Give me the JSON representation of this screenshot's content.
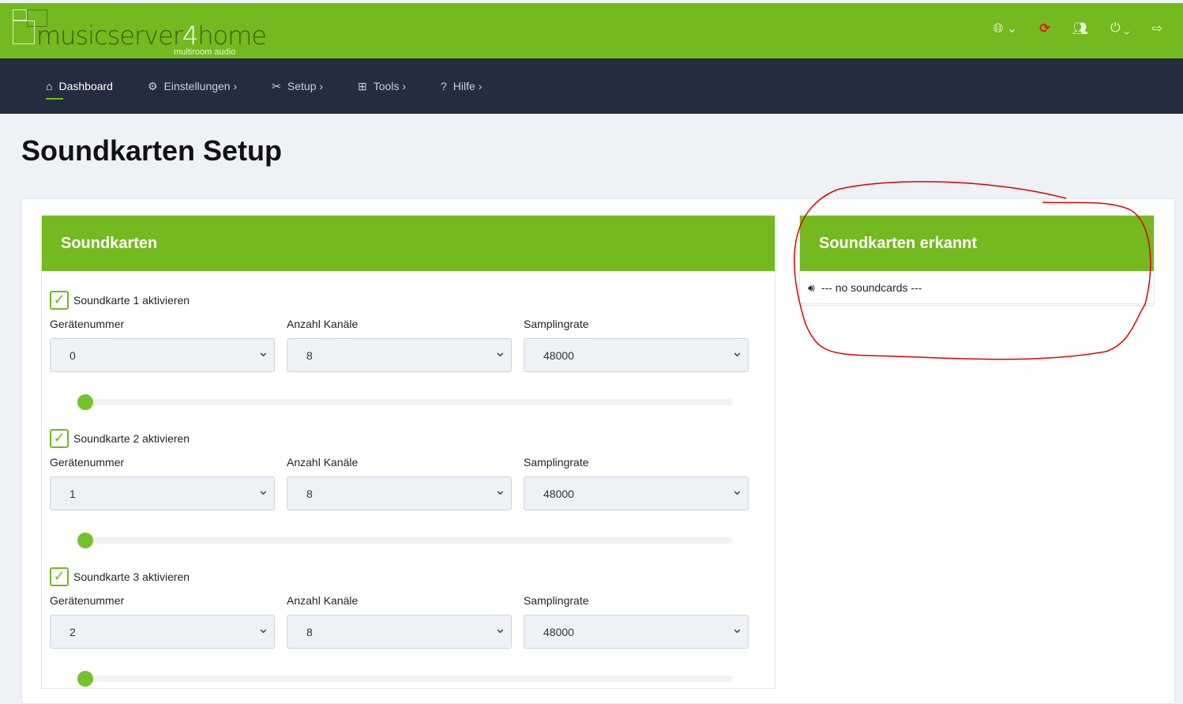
{
  "brand": {
    "name_a": "musicserver",
    "name_b": "4",
    "name_c": "home",
    "tagline": "multiroom audio"
  },
  "nav": [
    {
      "icon": "⌂",
      "label": "Dashboard"
    },
    {
      "icon": "⚙",
      "label": "Einstellungen ›"
    },
    {
      "icon": "✂",
      "label": "Setup ›"
    },
    {
      "icon": "⊞",
      "label": "Tools ›"
    },
    {
      "icon": "?",
      "label": "Hilfe ›"
    }
  ],
  "page_title": "Soundkarten Setup",
  "left_panel": {
    "title": "Soundkarten",
    "labels": {
      "device": "Gerätenummer",
      "channels": "Anzahl Kanäle",
      "rate": "Samplingrate"
    },
    "cards": [
      {
        "check": "Soundkarte 1 aktivieren",
        "device": "0",
        "channels": "8",
        "rate": "48000",
        "slider": 0
      },
      {
        "check": "Soundkarte 2 aktivieren",
        "device": "1",
        "channels": "8",
        "rate": "48000",
        "slider": 0
      },
      {
        "check": "Soundkarte 3 aktivieren",
        "device": "2",
        "channels": "8",
        "rate": "48000",
        "slider": 0
      }
    ]
  },
  "right_panel": {
    "title": "Soundkarten erkannt",
    "item": "--- no soundcards ---"
  },
  "colors": {
    "green": "#74b91f",
    "nav": "#242d3f",
    "annotation": "#e00000"
  }
}
